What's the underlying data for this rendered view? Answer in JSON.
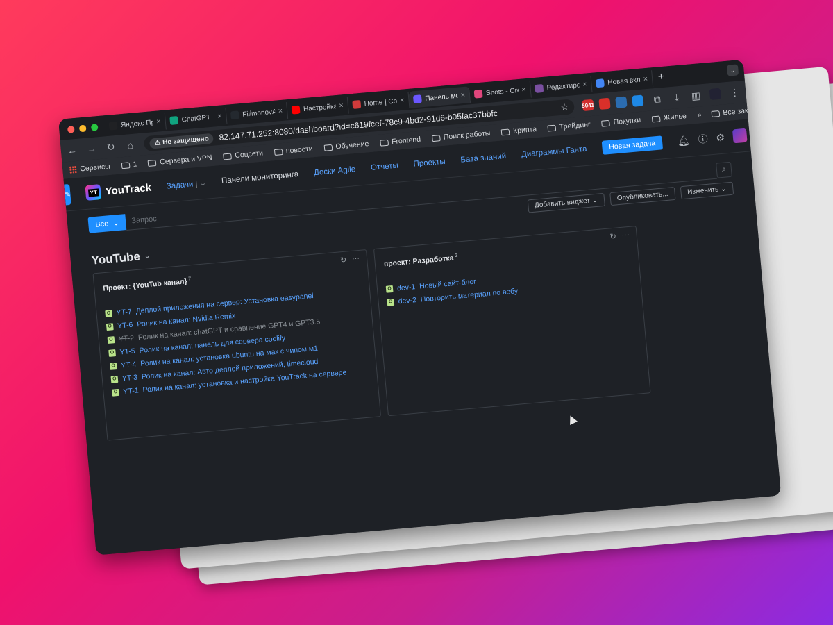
{
  "browser": {
    "tabs": [
      {
        "title": "Яндекс Про",
        "icon": "yandex-pro-icon",
        "color": "#202124",
        "active": false
      },
      {
        "title": "ChatGPT",
        "icon": "chatgpt-icon",
        "color": "#10a37f",
        "active": false
      },
      {
        "title": "FilimonovAl",
        "icon": "github-icon",
        "color": "#24292f",
        "active": false
      },
      {
        "title": "Настройка",
        "icon": "youtube-icon",
        "color": "#ff0000",
        "active": false
      },
      {
        "title": "Home | Coo",
        "icon": "coolify-icon",
        "color": "#d13b3b",
        "active": false
      },
      {
        "title": "Панель мо",
        "icon": "youtrack-icon",
        "color": "#6b57ff",
        "active": true
      },
      {
        "title": "Shots - Cre",
        "icon": "shots-icon",
        "color": "#e0467c",
        "active": false
      },
      {
        "title": "Редактиро",
        "icon": "editor-icon",
        "color": "#7a4fa0",
        "active": false
      },
      {
        "title": "Новая вкл",
        "icon": "chrome-icon",
        "color": "#4285f4",
        "active": false
      }
    ],
    "address": {
      "security": "Не защищено",
      "url": "82.147.71.252:8080/dashboard?id=c619fcef-78c9-4bd2-91d6-b05fac37bbfc"
    },
    "extensions": [
      {
        "label": "5041",
        "color": "#d32f2f"
      },
      {
        "label": "",
        "color": "#d9302a"
      },
      {
        "label": "",
        "color": "#2b6cb0"
      },
      {
        "label": "",
        "color": "#1e88e5"
      }
    ],
    "bookmarks": [
      "Сервисы",
      "1",
      "Сервера и VPN",
      "Соцсети",
      "новости",
      "Обучение",
      "Frontend",
      "Поиск работы",
      "Крипта",
      "Трейдинг",
      "Покупки",
      "Жилье"
    ],
    "bookmarks_right": "Все закладки"
  },
  "youtrack": {
    "brand": "YouTrack",
    "logo_text": "YT",
    "nav": {
      "issues": "Задачи",
      "dashboards": "Панели мониторинга",
      "agile": "Доски Agile",
      "reports": "Отчеты",
      "projects": "Проекты",
      "kb": "База знаний",
      "gantt": "Диаграммы Ганта",
      "new_issue": "Новая задача"
    },
    "search": {
      "scope": "Все",
      "placeholder": "Запрос"
    },
    "actions": {
      "add_widget": "Добавить виджет",
      "publish": "Опубликовать...",
      "edit": "Изменить"
    },
    "dashboard_title": "YouTube",
    "widgets": [
      {
        "title": "Проект: {YouTub канал}",
        "count": "7",
        "issues": [
          {
            "id": "YT-7",
            "summary": "Деплой приложения на сервер: Установка easypanel",
            "resolved": false
          },
          {
            "id": "YT-6",
            "summary": "Ролик на канал: Nvidia Remix",
            "resolved": false
          },
          {
            "id": "YT-2",
            "summary": "Ролик на канал: chatGPT и сравнение GPT4 и GPT3.5",
            "resolved": true
          },
          {
            "id": "YT-5",
            "summary": "Ролик на канал: панель для сервера coolify",
            "resolved": false
          },
          {
            "id": "YT-4",
            "summary": "Ролик на канал: установка ubuntu на мак с чипом м1",
            "resolved": false
          },
          {
            "id": "YT-3",
            "summary": "Ролик на канал: Авто деплой приложений, timecloud",
            "resolved": false
          },
          {
            "id": "YT-1",
            "summary": "Ролик на канал: установка и настройка YouTrack на сервере",
            "resolved": false
          }
        ]
      },
      {
        "title": "проект: Разработка",
        "count": "2",
        "issues": [
          {
            "id": "dev-1",
            "summary": "Новый сайт-блог",
            "resolved": false
          },
          {
            "id": "dev-2",
            "summary": "Повторить материал по вебу",
            "resolved": false
          }
        ]
      }
    ],
    "issue_state_badge": "O"
  }
}
